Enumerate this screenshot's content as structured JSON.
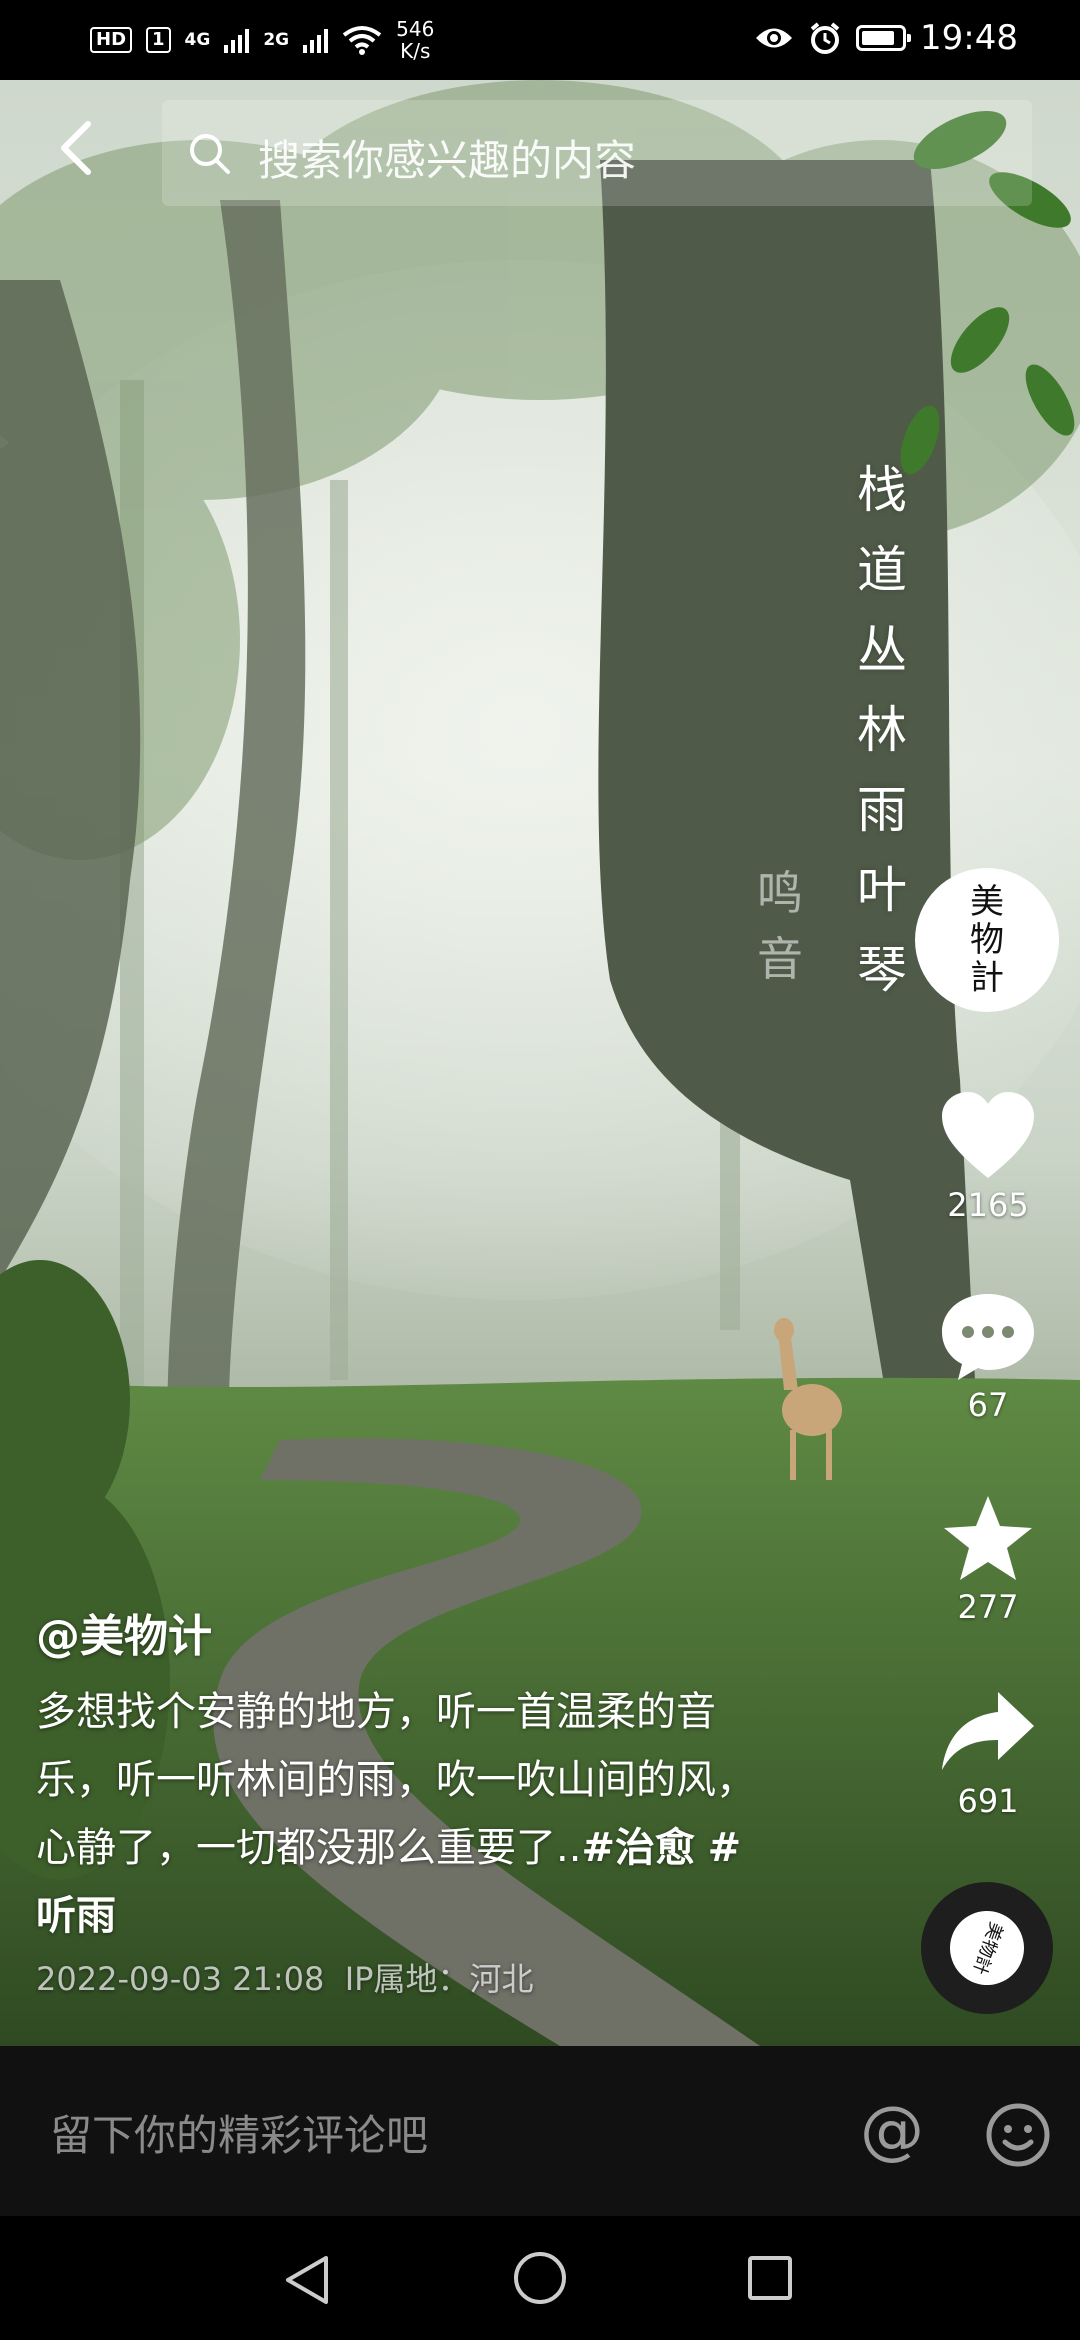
{
  "status_bar": {
    "hd": "HD",
    "sim1": "1",
    "sim1_net": "4G",
    "sim2_net": "2G",
    "speed_value": "546",
    "speed_unit": "K/s",
    "time": "19:48",
    "battery_fraction": 0.85
  },
  "search": {
    "placeholder": "搜索你感兴趣的内容"
  },
  "overlay": {
    "title_chars": [
      "栈",
      "道",
      "丛",
      "林",
      "雨",
      "叶",
      "琴"
    ],
    "sub_chars": [
      "鸣",
      "音"
    ]
  },
  "author_avatar": {
    "lines": [
      "美",
      "物",
      "計"
    ]
  },
  "actions": {
    "like_count": "2165",
    "comment_count": "67",
    "favorite_count": "277",
    "share_count": "691"
  },
  "post": {
    "author": "@美物计",
    "description": "多想找个安静的地方，听一首温柔的音乐，听一听林间的雨，吹一吹山间的风，心静了，一切都没那么重要了..",
    "tags": [
      "#治愈",
      "#听雨"
    ],
    "datetime": "2022-09-03 21:08",
    "ip_location": "IP属地：河北"
  },
  "music_disc": {
    "label": "美物計"
  },
  "comment_bar": {
    "placeholder": "留下你的精彩评论吧",
    "at_symbol": "@"
  },
  "icons": {
    "back": "chevron-left",
    "search": "magnifier",
    "like": "heart",
    "comment": "speech-bubble-dots",
    "favorite": "star",
    "share": "share-arrow",
    "emoji": "smiley-face"
  }
}
